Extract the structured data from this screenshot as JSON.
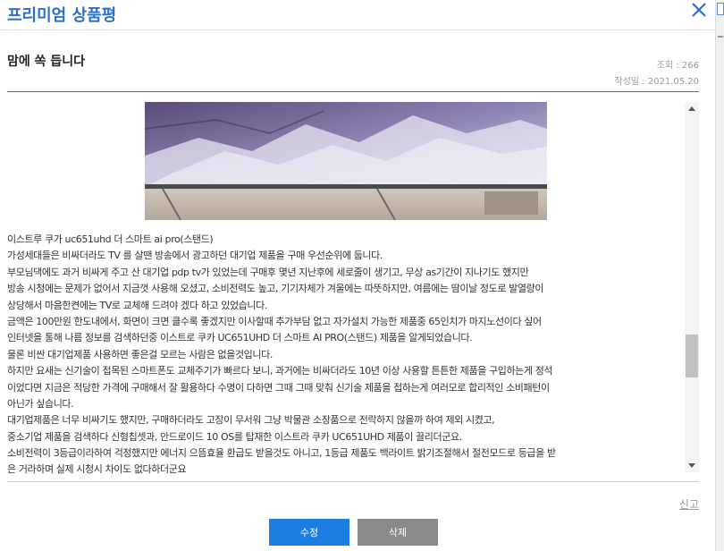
{
  "header": {
    "title": "프리미엄 상품평"
  },
  "review": {
    "title": "맘에 쏙 듭니다",
    "views": "조회 : 266",
    "date": "작성일 : 2021.05.20",
    "body_lines": [
      "이스트루 쿠가 uc651uhd 더 스마트 ai pro(스탠드)",
      "가성세대들은 비싸더라도 TV 를 살땐 방송에서 광고하던 대기업 제품을 구매 우선순위에 둡니다.",
      "부모님댁에도 과거 비싸게 주고 산 대기업 pdp tv가 있었는데 구매후 몇년 지난후에 세로줄이 생기고, 무상 as기간이 지나기도 했지만",
      "방송 시청에는 문제가 없어서 지금껏 사용해 오셨고, 소비전력도 높고, 기기자체가 겨울에는 따뜻하지만, 여름에는 땀이날 정도로 발열량이",
      "상당해서 마음한켠에는 TV로 교체해 드려야 겠다 하고 있었습니다.",
      "금액은 100만원 한도내에서, 화면이 크면 클수록 좋겠지만 이사할때 추가부담 없고 자가설치 가능한 제품중 65인치가 마지노선이다 싶어",
      "인터넷을 통해 나름 정보를 검색하던중 이스트로 쿠카 UC651UHD 더 스마트 AI PRO(스탠드) 제품을 알게되었습니다.",
      "물론 비싼 대기업제품 사용하면 좋은걸 모르는 사람은 없을것입니다.",
      "하지만 요새는 신기술이 접목된 스마트폰도 교체주기가 빠르다 보니, 과거에는 비싸더라도 10년 이상 사용할 튼튼한 제품을 구입하는게 정석",
      "이었다면 지금은 적당한 가격에 구매해서 잘 활용하다 수명이 다하면 그때 그때 맞춰 신기술 제품을 접하는게 여러모로 합리적인 소비패턴이",
      "아닌가 싶습니다.",
      "대기업제품은 너무 비싸기도 했지만, 구매하더라도 고장이 무서워 그냥 박물관 소장품으로 전락하지 않을까 하여 제외 시켰고,",
      "중소기업 제품을 검색하다 신형칩셋과, 안드로이드 10 OS를 탑재한 이스트라 쿠카 UC651UHD 제품이 끌리더군요.",
      "소비전력이 3등급이라하여 걱정했지만 에너지 으뜸효율 환급도 받을것도 아니고, 1등급 제품도 백라이트 밝기조절해서 절전모드로 등급을 받",
      "은 거라하며 실제 시청시 차이도 없다하더군요"
    ]
  },
  "actions": {
    "report_label": "신고",
    "edit_label": "수정",
    "delete_label": "삭제"
  },
  "icons": {
    "close": "close-icon",
    "scroll_up": "scroll-up-icon",
    "scroll_down": "scroll-down-icon"
  },
  "colors": {
    "title_blue": "#2a6fc9",
    "edit_button": "#1a7fe0",
    "delete_button": "#8a8a8a"
  }
}
